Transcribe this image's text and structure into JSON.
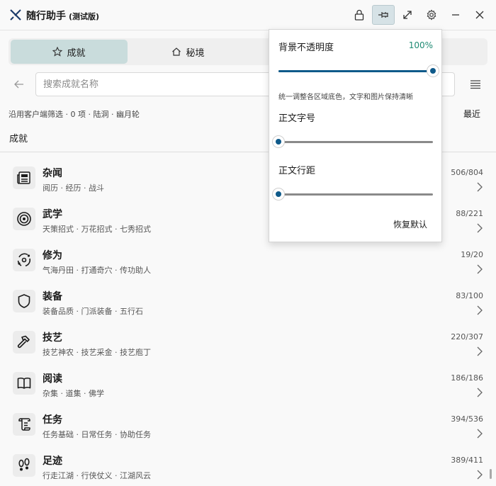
{
  "app": {
    "title": "随行助手",
    "subtitle": "(测试版)"
  },
  "titlebar": {
    "buttons": [
      "lock-icon",
      "pin-icon",
      "expand-icon",
      "gear-icon",
      "minimize-icon",
      "close-icon"
    ]
  },
  "tabs": [
    {
      "label": "成就",
      "icon": "star-icon",
      "active": true
    },
    {
      "label": "秘境",
      "icon": "home-icon",
      "active": false
    }
  ],
  "search": {
    "placeholder": "搜索成就名称"
  },
  "filter_text": "沿用客户端筛选 · 0 项 · 陆洞 · 幽月轮",
  "sort_label": "最近",
  "section_title": "成就",
  "categories": [
    {
      "title": "杂闻",
      "sub": "阅历 · 经历 · 战斗",
      "count": "506/804",
      "icon": "newspaper-icon"
    },
    {
      "title": "武学",
      "sub": "天策招式 · 万花招式 · 七秀招式",
      "count": "88/221",
      "icon": "target-icon"
    },
    {
      "title": "修为",
      "sub": "气海丹田 · 打通奇穴 · 传功助人",
      "count": "19/20",
      "icon": "orbit-icon"
    },
    {
      "title": "装备",
      "sub": "装备品质 · 门派装备 · 五行石",
      "count": "83/100",
      "icon": "shield-icon"
    },
    {
      "title": "技艺",
      "sub": "技艺神农 · 技艺采金 · 技艺庖丁",
      "count": "220/307",
      "icon": "hammer-icon"
    },
    {
      "title": "阅读",
      "sub": "杂集 · 道集 · 佛学",
      "count": "186/186",
      "icon": "book-icon"
    },
    {
      "title": "任务",
      "sub": "任务基础 · 日常任务 · 协助任务",
      "count": "394/536",
      "icon": "scroll-icon"
    },
    {
      "title": "足迹",
      "sub": "行走江湖 · 行侠仗义 · 江湖风云",
      "count": "389/411",
      "icon": "footprints-icon"
    }
  ],
  "popup": {
    "opacity_label": "背景不透明度",
    "opacity_value": "100%",
    "opacity_level": 1.0,
    "note": "统一调整各区域底色，文字和图片保持清晰",
    "font_size_label": "正文字号",
    "font_size_level": 0.0,
    "line_spacing_label": "正文行距",
    "line_spacing_level": 0.0,
    "reset_label": "恢复默认"
  },
  "colors": {
    "accent": "#0f5a8a",
    "tab_active": "#c9dcdc",
    "value_text": "#1f8a73"
  }
}
